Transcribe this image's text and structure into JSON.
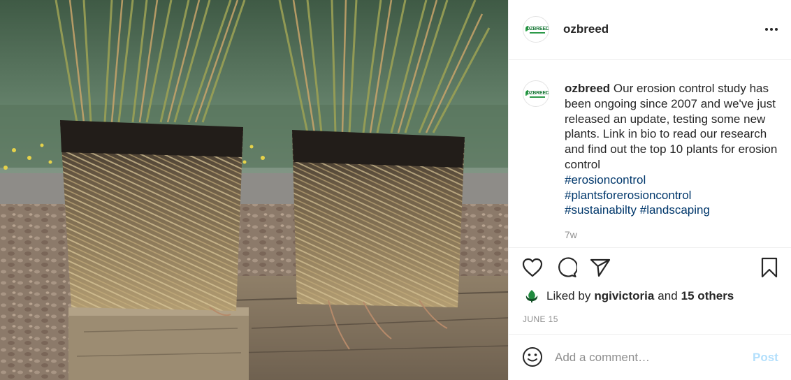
{
  "post": {
    "username": "ozbreed",
    "avatar_logo_text": "OZBREED",
    "caption": {
      "username": "ozbreed",
      "body": "Our erosion control study has been ongoing since 2007 and we've just released an update, testing some new plants. Link in bio to read our research and find out the top 10 plants for erosion control",
      "hashtags": [
        "#erosioncontrol",
        "#plantsforerosioncontrol",
        "#sustainabilty",
        "#landscaping"
      ],
      "age": "7w"
    },
    "likes": {
      "prefix": "Liked by",
      "user": "ngivictoria",
      "conjunction": "and",
      "others": "15 others"
    },
    "date": "JUNE 15"
  },
  "comment": {
    "placeholder": "Add a comment…",
    "post_label": "Post"
  },
  "icons": {
    "more": "more-options-icon",
    "like": "heart-icon",
    "comment": "comment-icon",
    "share": "paper-plane-icon",
    "save": "bookmark-icon",
    "emoji": "smiley-icon"
  },
  "colors": {
    "link": "#00376b",
    "muted": "#8e8e8e",
    "post_disabled": "#b2dffc",
    "text": "#262626"
  }
}
